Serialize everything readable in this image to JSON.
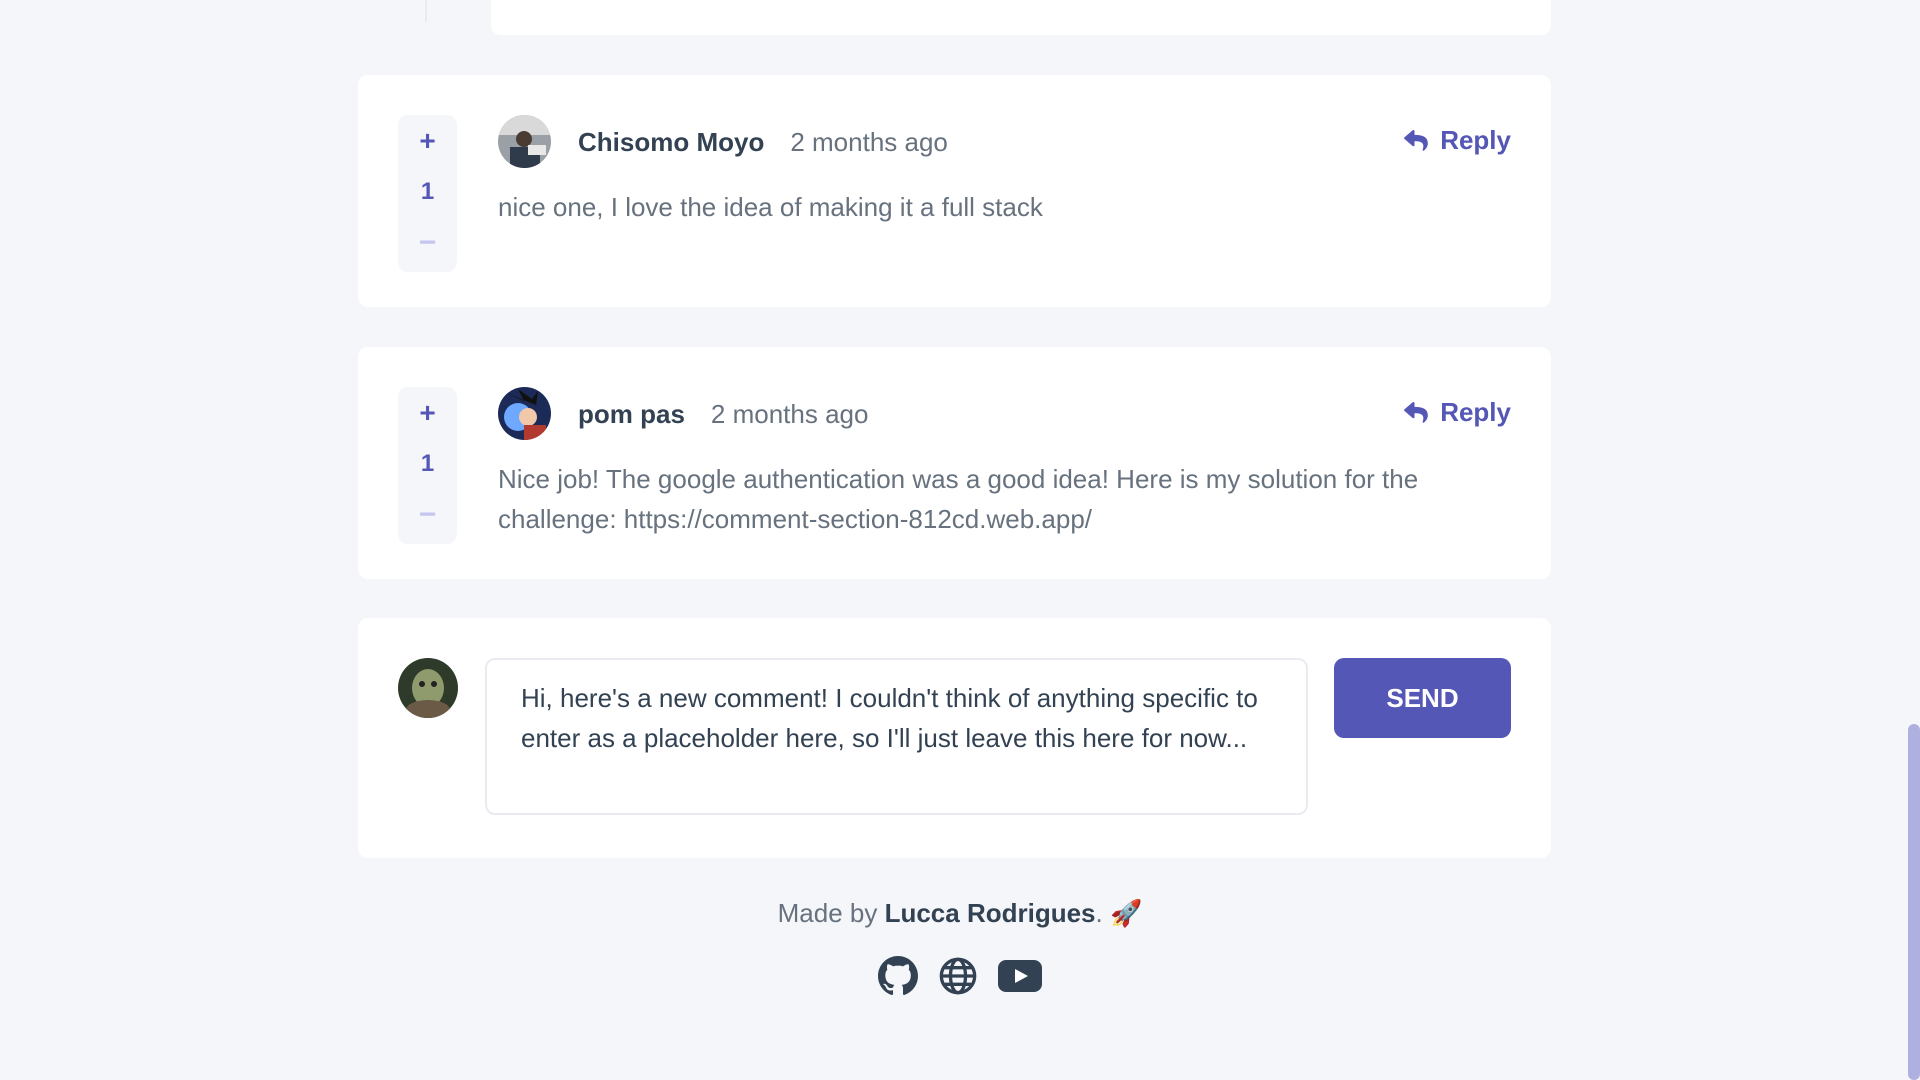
{
  "comments": [
    {
      "username": "Chisomo Moyo",
      "time": "2 months ago",
      "score": "1",
      "text": "nice one, I love the idea of making it a full stack",
      "reply_label": "Reply"
    },
    {
      "username": "pom pas",
      "time": "2 months ago",
      "score": "1",
      "text": "Nice job! The google authentication was a good idea! Here is my solution for the challenge: https://comment-section-812cd.web.app/",
      "reply_label": "Reply"
    }
  ],
  "vote": {
    "plus": "+",
    "minus": "−"
  },
  "new_comment": {
    "text": "Hi, here's a new comment! I couldn't think of anything specific to enter as a placeholder here, so I'll just leave this here for now...",
    "send_label": "SEND"
  },
  "footer": {
    "prefix": "Made by ",
    "author": "Lucca Rodrigues",
    "suffix": ".",
    "emoji": "🚀"
  },
  "social_icons": [
    "github-icon",
    "globe-icon",
    "youtube-icon"
  ],
  "colors": {
    "accent": "#5457b6",
    "accent_light": "#c5c6ef",
    "dark_text": "#334253",
    "body_text": "#67727e",
    "background": "#f5f6fa"
  }
}
